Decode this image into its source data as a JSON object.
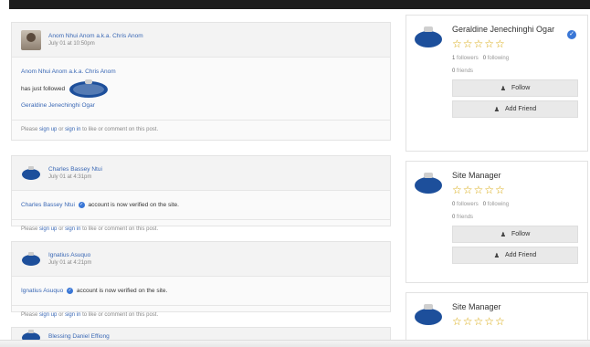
{
  "feed": {
    "posts": [
      {
        "author": "Anom Nhui Anom a.k.a. Chris Anom",
        "time": "July 01 at 10:50pm",
        "line1": "Anom Nhui Anom a.k.a. Chris Anom",
        "line2": "has just followed",
        "line3": "Geraldine Jenechinghi Ogar",
        "foot_pre": "Please",
        "sign_up": "sign up",
        "or": "or",
        "sign_in": "sign in",
        "foot_post": "to like or comment on this post."
      },
      {
        "author": "Charles Bassey Ntui",
        "time": "July 01 at 4:31pm",
        "who": "Charles Bassey Ntui",
        "text": "account is now verified on the site.",
        "foot_pre": "Please",
        "sign_up": "sign up",
        "or": "or",
        "sign_in": "sign in",
        "foot_post": "to like or comment on this post."
      },
      {
        "author": "Ignatius Asuquo",
        "time": "July 01 at 4:21pm",
        "who": "Ignatius Asuquo",
        "text": "account is now verified on the site.",
        "foot_pre": "Please",
        "sign_up": "sign up",
        "or": "or",
        "sign_in": "sign in",
        "foot_post": "to like or comment on this post."
      },
      {
        "author": "Blessing Daniel Effiong"
      }
    ]
  },
  "sidebar": {
    "profiles": [
      {
        "name": "Geraldine Jenechinghi Ogar",
        "stars": "☆☆☆☆☆",
        "followers_n": "1",
        "followers_l": "followers",
        "following_n": "0",
        "following_l": "following",
        "friends_n": "0",
        "friends_l": "friends",
        "follow": "Follow",
        "add_friend": "Add Friend"
      },
      {
        "name": "Site Manager",
        "stars": "☆☆☆☆☆",
        "followers_n": "0",
        "followers_l": "followers",
        "following_n": "0",
        "following_l": "following",
        "friends_n": "0",
        "friends_l": "friends",
        "follow": "Follow",
        "add_friend": "Add Friend"
      },
      {
        "name": "Site Manager",
        "stars": "☆☆☆☆☆"
      }
    ]
  },
  "colors": {
    "link": "#3a68b5",
    "star": "#d6a400",
    "verified": "#3a77d6"
  },
  "icons": {
    "verified": "check-badge-icon",
    "follow": "user-icon",
    "add_friend": "user-plus-icon"
  }
}
